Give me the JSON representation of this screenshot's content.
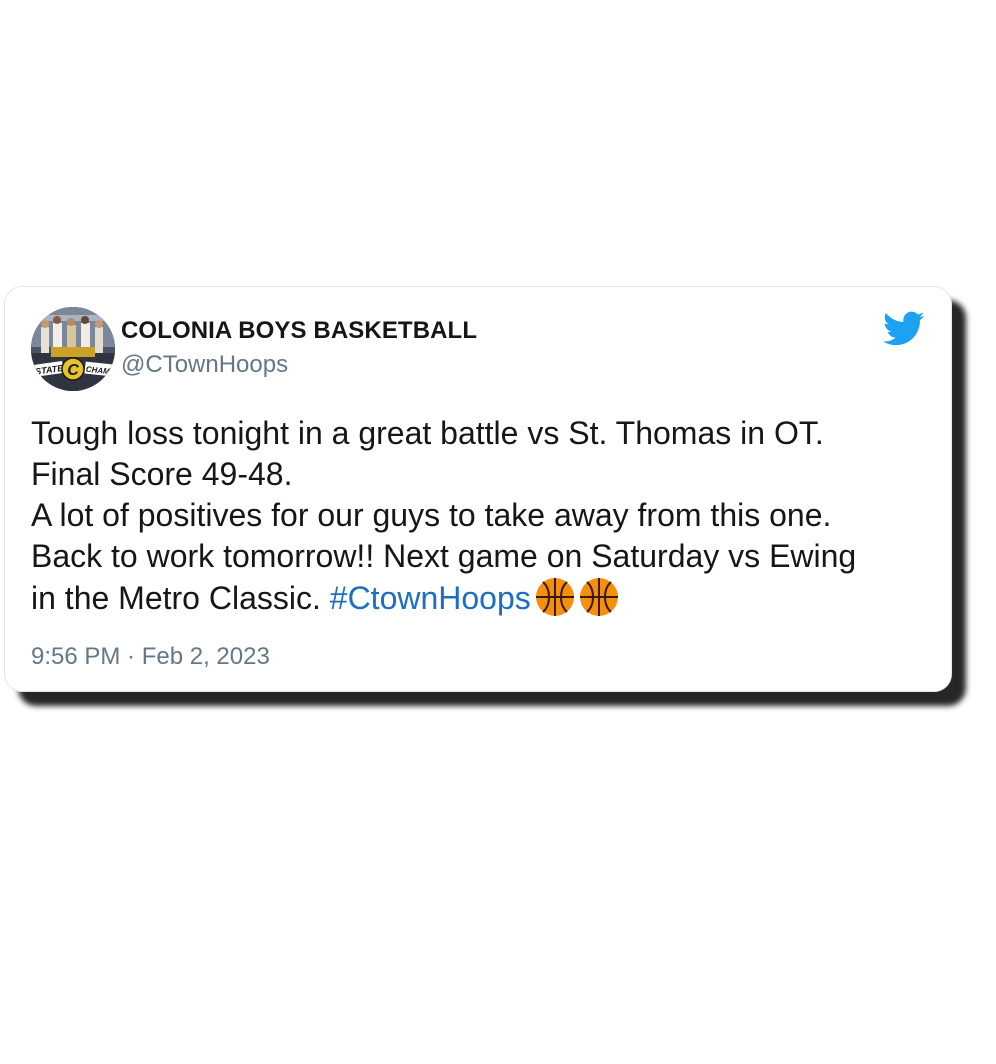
{
  "tweet": {
    "author_name": "COLONIA BOYS BASKETBALL",
    "handle": "@CTownHoops",
    "avatar_text": {
      "left": "STATE",
      "center": "C",
      "right": "CHAMP"
    },
    "body_lines": [
      "Tough loss tonight in a great battle vs St. Thomas in OT.",
      "Final Score 49-48.",
      "A lot of positives for our guys to take away from this one.",
      "Back to work tomorrow!! Next game on Saturday vs Ewing",
      "in the Metro Classic. "
    ],
    "hashtag": "#CtownHoops",
    "emoji": [
      "basketball-emoji",
      "basketball-emoji"
    ],
    "timestamp": "9:56 PM · Feb 2, 2023"
  },
  "icons": {
    "brand": "twitter-bird-icon"
  },
  "colors": {
    "twitter_blue": "#1da1f2",
    "hashtag": "#1b6ec2",
    "secondary_text": "#657786",
    "primary_text": "#14171a",
    "basketball": "#f4900c"
  }
}
